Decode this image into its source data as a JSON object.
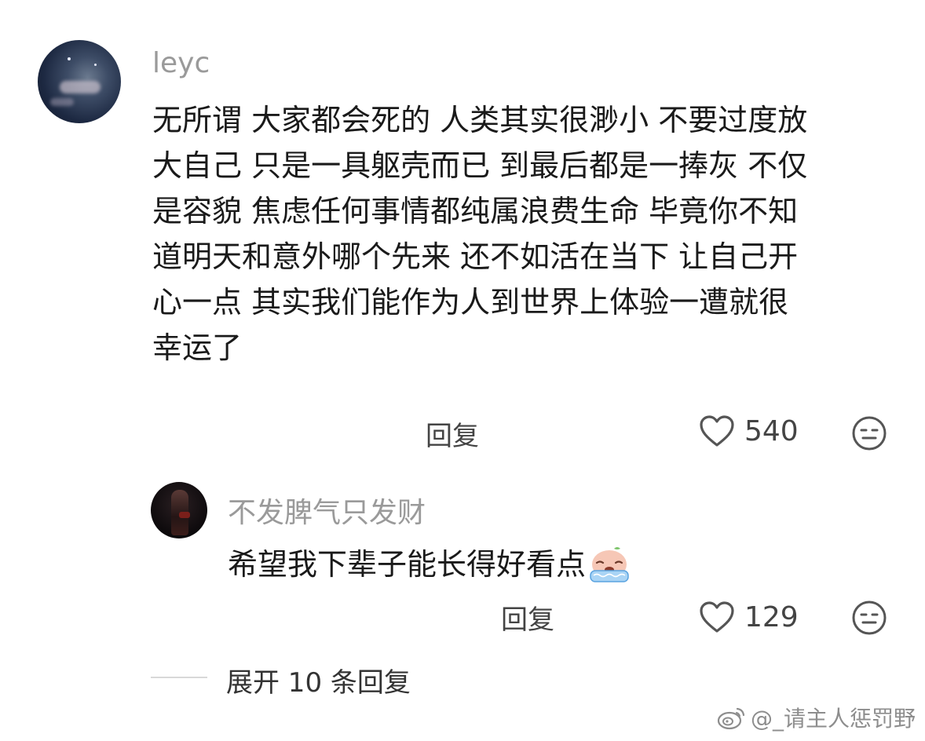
{
  "comments": [
    {
      "username": "leyc",
      "text_lines": [
        "无所谓 大家都会死的 人类其实很渺小 不要过度放",
        "大自己 只是一具躯壳而已 到最后都是一捧灰 不仅",
        "是容貌 焦虑任何事情都纯属浪费生命 毕竟你不知",
        "道明天和意外哪个先来 还不如活在当下 让自己开",
        "心一点 其实我们能作为人到世界上体验一遭就很",
        "幸运了"
      ],
      "reply_label": "回复",
      "like_count": "540",
      "avatar_icon": "night-sky-avatar"
    },
    {
      "username": "不发脾气只发财",
      "text": "希望我下辈子能长得好看点",
      "emoji_icon": "crying-emoji",
      "reply_label": "回复",
      "like_count": "129",
      "avatar_icon": "dark-portrait-avatar"
    }
  ],
  "expand_replies": "展开 10 条回复",
  "watermark": {
    "icon": "weibo-icon",
    "text": "@_请主人惩罚野"
  },
  "colors": {
    "username": "#9a9a9a",
    "body_text": "#1a1a1a",
    "icon_gray": "#555555"
  }
}
